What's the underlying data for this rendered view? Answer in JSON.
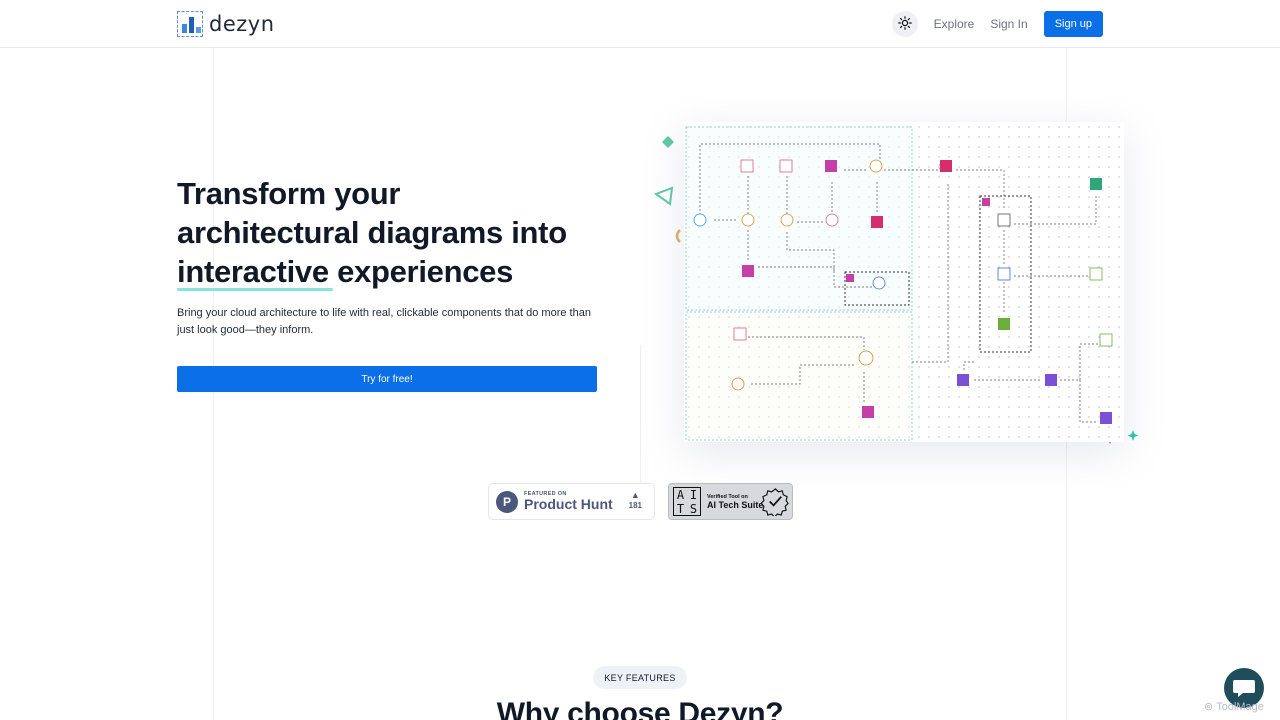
{
  "header": {
    "logo_text": "dezyn",
    "nav": {
      "explore": "Explore",
      "sign_in": "Sign In",
      "sign_up": "Sign up"
    }
  },
  "hero": {
    "title_line1": "Transform your",
    "title_line2": "architectural diagrams into",
    "title_highlight": "interactive",
    "title_line3_rest": " experiences",
    "subtitle": "Bring your cloud architecture to life with real, clickable components that do more than just look good—they inform.",
    "cta": "Try for free!"
  },
  "badges": {
    "product_hunt": {
      "small": "FEATURED ON",
      "big": "Product Hunt",
      "count": "181"
    },
    "ai_tech": {
      "grid": [
        "A",
        "I",
        "T",
        "S"
      ],
      "small": "Verified Tool on",
      "big": "AI Tech Suite"
    }
  },
  "features": {
    "pill": "KEY FEATURES",
    "heading": "Why choose Dezyn?"
  },
  "watermark": "ToolMage",
  "colors": {
    "primary": "#0b6fe8",
    "accent_teal": "#86e5da",
    "chat": "#1f4d5b"
  }
}
